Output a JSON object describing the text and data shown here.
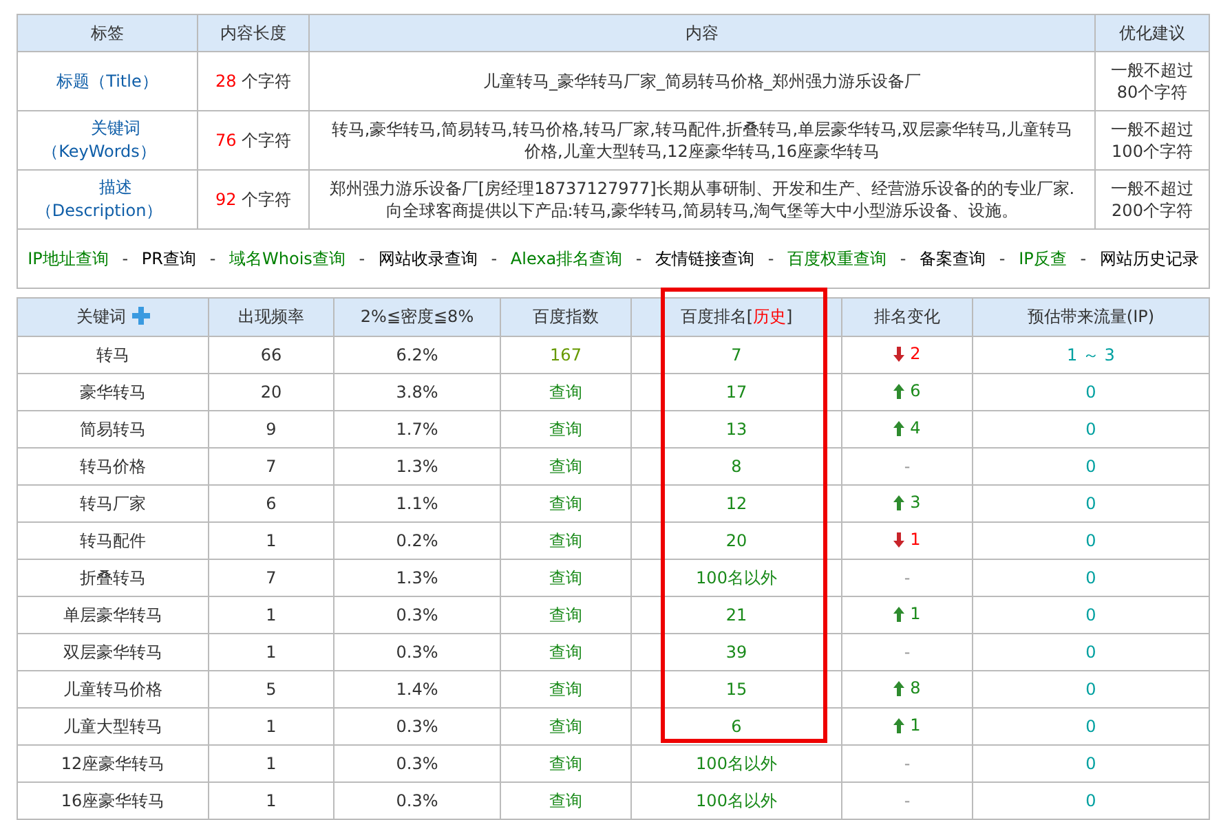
{
  "meta_table": {
    "columns": [
      "标签",
      "内容长度",
      "内容",
      "优化建议"
    ],
    "rows": [
      {
        "label": "标题（Title）",
        "count": "28",
        "unit": "个字符",
        "content": "儿童转马_豪华转马厂家_简易转马价格_郑州强力游乐设备厂",
        "advice": "一般不超过80个字符"
      },
      {
        "label": "关键词（KeyWords）",
        "count": "76",
        "unit": "个字符",
        "content": "转马,豪华转马,简易转马,转马价格,转马厂家,转马配件,折叠转马,单层豪华转马,双层豪华转马,儿童转马价格,儿童大型转马,12座豪华转马,16座豪华转马",
        "advice": "一般不超过100个字符"
      },
      {
        "label": "描述（Description）",
        "count": "92",
        "unit": "个字符",
        "content": "郑州强力游乐设备厂[房经理18737127977]长期从事研制、开发和生产、经营游乐设备的的专业厂家.向全球客商提供以下产品:转马,豪华转马,简易转马,淘气堡等大中小型游乐设备、设施。",
        "advice": "一般不超过200个字符"
      }
    ],
    "tools": [
      {
        "kind": "link",
        "text": "IP地址查询",
        "color": "#008000"
      },
      {
        "kind": "separator",
        "text": "-"
      },
      {
        "kind": "link",
        "text": "PR查询",
        "color": "#000000"
      },
      {
        "kind": "separator",
        "text": "-"
      },
      {
        "kind": "link",
        "text": "域名Whois查询",
        "color": "#008000"
      },
      {
        "kind": "separator",
        "text": "-"
      },
      {
        "kind": "link",
        "text": "网站收录查询",
        "color": "#000000"
      },
      {
        "kind": "separator",
        "text": "-"
      },
      {
        "kind": "link",
        "text": "Alexa排名查询",
        "color": "#008000"
      },
      {
        "kind": "separator",
        "text": "-"
      },
      {
        "kind": "link",
        "text": "友情链接查询",
        "color": "#000000"
      },
      {
        "kind": "separator",
        "text": "-"
      },
      {
        "kind": "link",
        "text": "百度权重查询",
        "color": "#008000"
      },
      {
        "kind": "separator",
        "text": "-"
      },
      {
        "kind": "link",
        "text": "备案查询",
        "color": "#000000"
      },
      {
        "kind": "separator",
        "text": "-"
      },
      {
        "kind": "link",
        "text": "IP反查",
        "color": "#008000"
      },
      {
        "kind": "separator",
        "text": "-"
      },
      {
        "kind": "link",
        "text": "网站历史记录",
        "color": "#000000"
      }
    ]
  },
  "keyword_table": {
    "columns": [
      {
        "text": "关键词",
        "kind": "add"
      },
      {
        "text": "出现频率",
        "kind": "plain"
      },
      {
        "text": "2%≦密度≦8%",
        "kind": "plain"
      },
      {
        "text": "百度指数",
        "kind": "plain"
      },
      {
        "text": "百度排名[",
        "link": "历史",
        "after": "]",
        "kind": "history"
      },
      {
        "text": "排名变化",
        "kind": "plain"
      },
      {
        "text": "预估带来流量(IP)",
        "kind": "plain"
      }
    ],
    "rows": [
      {
        "keyword": "转马",
        "frequency": "66",
        "density": "6.2%",
        "index": {
          "kind": "value",
          "text": "167"
        },
        "rank": "7",
        "change": {
          "kind": "down",
          "text": "2"
        },
        "traffic": "1 ～ 3"
      },
      {
        "keyword": "豪华转马",
        "frequency": "20",
        "density": "3.8%",
        "index": {
          "kind": "link",
          "text": "查询"
        },
        "rank": "17",
        "change": {
          "kind": "up",
          "text": "6"
        },
        "traffic": "0"
      },
      {
        "keyword": "简易转马",
        "frequency": "9",
        "density": "1.7%",
        "index": {
          "kind": "link",
          "text": "查询"
        },
        "rank": "13",
        "change": {
          "kind": "up",
          "text": "4"
        },
        "traffic": "0"
      },
      {
        "keyword": "转马价格",
        "frequency": "7",
        "density": "1.3%",
        "index": {
          "kind": "link",
          "text": "查询"
        },
        "rank": "8",
        "change": {
          "kind": "none",
          "text": "-"
        },
        "traffic": "0"
      },
      {
        "keyword": "转马厂家",
        "frequency": "6",
        "density": "1.1%",
        "index": {
          "kind": "link",
          "text": "查询"
        },
        "rank": "12",
        "change": {
          "kind": "up",
          "text": "3"
        },
        "traffic": "0"
      },
      {
        "keyword": "转马配件",
        "frequency": "1",
        "density": "0.2%",
        "index": {
          "kind": "link",
          "text": "查询"
        },
        "rank": "20",
        "change": {
          "kind": "down",
          "text": "1"
        },
        "traffic": "0"
      },
      {
        "keyword": "折叠转马",
        "frequency": "7",
        "density": "1.3%",
        "index": {
          "kind": "link",
          "text": "查询"
        },
        "rank": "100名以外",
        "change": {
          "kind": "none",
          "text": "-"
        },
        "traffic": "0"
      },
      {
        "keyword": "单层豪华转马",
        "frequency": "1",
        "density": "0.3%",
        "index": {
          "kind": "link",
          "text": "查询"
        },
        "rank": "21",
        "change": {
          "kind": "up",
          "text": "1"
        },
        "traffic": "0"
      },
      {
        "keyword": "双层豪华转马",
        "frequency": "1",
        "density": "0.3%",
        "index": {
          "kind": "link",
          "text": "查询"
        },
        "rank": "39",
        "change": {
          "kind": "none",
          "text": "-"
        },
        "traffic": "0"
      },
      {
        "keyword": "儿童转马价格",
        "frequency": "5",
        "density": "1.4%",
        "index": {
          "kind": "link",
          "text": "查询"
        },
        "rank": "15",
        "change": {
          "kind": "up",
          "text": "8"
        },
        "traffic": "0"
      },
      {
        "keyword": "儿童大型转马",
        "frequency": "1",
        "density": "0.3%",
        "index": {
          "kind": "link",
          "text": "查询"
        },
        "rank": "6",
        "change": {
          "kind": "up",
          "text": "1"
        },
        "traffic": "0"
      },
      {
        "keyword": "12座豪华转马",
        "frequency": "1",
        "density": "0.3%",
        "index": {
          "kind": "link",
          "text": "查询"
        },
        "rank": "100名以外",
        "change": {
          "kind": "none",
          "text": "-"
        },
        "traffic": "0"
      },
      {
        "keyword": "16座豪华转马",
        "frequency": "1",
        "density": "0.3%",
        "index": {
          "kind": "link",
          "text": "查询"
        },
        "rank": "100名以外",
        "change": {
          "kind": "none",
          "text": "-"
        },
        "traffic": "0"
      }
    ]
  }
}
